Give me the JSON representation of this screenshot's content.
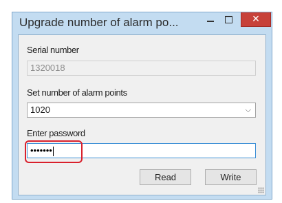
{
  "window": {
    "title": "Upgrade number of alarm po...",
    "minimize_glyph": "",
    "maximize_glyph": "",
    "close_glyph": "✕"
  },
  "form": {
    "serial_label": "Serial number",
    "serial_value": "1320018",
    "alarm_points_label": "Set number of alarm points",
    "alarm_points_value": "1020",
    "password_label": "Enter password",
    "password_mask": "•••••••"
  },
  "buttons": {
    "read": "Read",
    "write": "Write"
  },
  "colors": {
    "frame": "#c3dcf1",
    "close_button": "#c7413a",
    "focus_border": "#3c8fd6",
    "annotation": "#d9202c"
  },
  "icons": {
    "dropdown": "chevron-down-icon",
    "resize": "resize-grip-icon"
  }
}
